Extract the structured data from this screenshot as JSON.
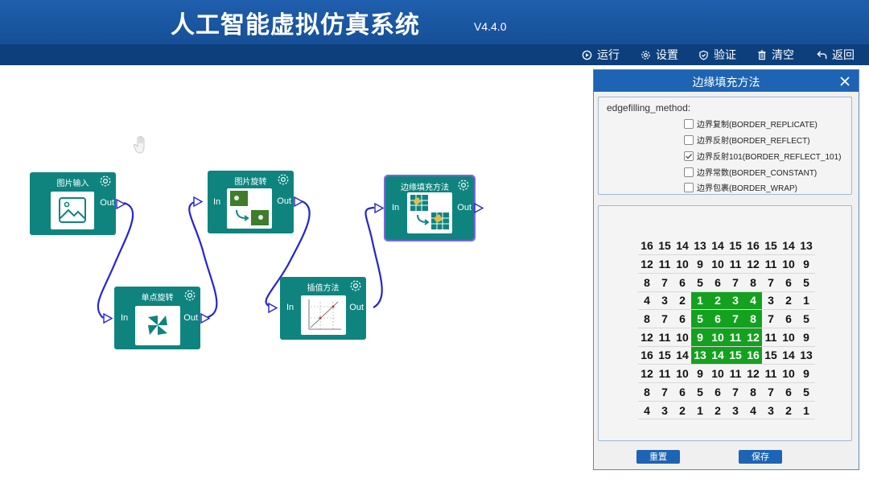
{
  "app": {
    "title": "人工智能虚拟仿真系统",
    "version": "V4.4.0"
  },
  "toolbar": {
    "items": [
      {
        "label": "运行",
        "icon": "play-circle-icon"
      },
      {
        "label": "设置",
        "icon": "gear-icon"
      },
      {
        "label": "验证",
        "icon": "shield-check-icon"
      },
      {
        "label": "清空",
        "icon": "trash-icon"
      },
      {
        "label": "返回",
        "icon": "return-arrow-icon"
      }
    ]
  },
  "nodes": [
    {
      "title": "图片输入",
      "in_label": "",
      "out_label": "Out",
      "icon": "image-icon"
    },
    {
      "title": "单点旋转",
      "in_label": "In",
      "out_label": "Out",
      "icon": "pinwheel-icon"
    },
    {
      "title": "图片旋转",
      "in_label": "In",
      "out_label": "Out",
      "icon": "image-rotate-icon"
    },
    {
      "title": "插值方法",
      "in_label": "In",
      "out_label": "Out",
      "icon": "interpolation-chart-icon"
    },
    {
      "title": "边缘填充方法",
      "in_label": "In",
      "out_label": "Out",
      "icon": "edge-fill-icon"
    }
  ],
  "dialog": {
    "title": "边缘填充方法",
    "param_label": "edgefilling_method:",
    "options": [
      {
        "label": "边界复制(BORDER_REPLICATE)",
        "checked": false
      },
      {
        "label": "边界反射(BORDER_REFLECT)",
        "checked": false
      },
      {
        "label": "边界反射101(BORDER_REFLECT_101)",
        "checked": true
      },
      {
        "label": "边界常数(BORDER_CONSTANT)",
        "checked": false
      },
      {
        "label": "边界包裹(BORDER_WRAP)",
        "checked": false
      }
    ],
    "grid": [
      [
        "16",
        "15",
        "14",
        "13",
        "14",
        "15",
        "16",
        "15",
        "14",
        "13"
      ],
      [
        "12",
        "11",
        "10",
        "9",
        "10",
        "11",
        "12",
        "11",
        "10",
        "9"
      ],
      [
        "8",
        "7",
        "6",
        "5",
        "6",
        "7",
        "8",
        "7",
        "6",
        "5"
      ],
      [
        "4",
        "3",
        "2",
        "1",
        "2",
        "3",
        "4",
        "3",
        "2",
        "1"
      ],
      [
        "8",
        "7",
        "6",
        "5",
        "6",
        "7",
        "8",
        "7",
        "6",
        "5"
      ],
      [
        "12",
        "11",
        "10",
        "9",
        "10",
        "11",
        "12",
        "11",
        "10",
        "9"
      ],
      [
        "16",
        "15",
        "14",
        "13",
        "14",
        "15",
        "16",
        "15",
        "14",
        "13"
      ],
      [
        "12",
        "11",
        "10",
        "9",
        "10",
        "11",
        "12",
        "11",
        "10",
        "9"
      ],
      [
        "8",
        "7",
        "6",
        "5",
        "6",
        "7",
        "8",
        "7",
        "6",
        "5"
      ],
      [
        "4",
        "3",
        "2",
        "1",
        "2",
        "3",
        "4",
        "3",
        "2",
        "1"
      ]
    ],
    "highlight_rows": [
      3,
      6
    ],
    "highlight_cols": [
      3,
      6
    ],
    "highlight_color": "#14a11f",
    "buttons": {
      "reset": "重置",
      "save": "保存"
    }
  },
  "colors": {
    "header": "#1f5fae",
    "toolbar": "#0e3f7d",
    "node": "#0f847f",
    "wire": "#2424d6",
    "selected_outline": "#7a67d8"
  }
}
